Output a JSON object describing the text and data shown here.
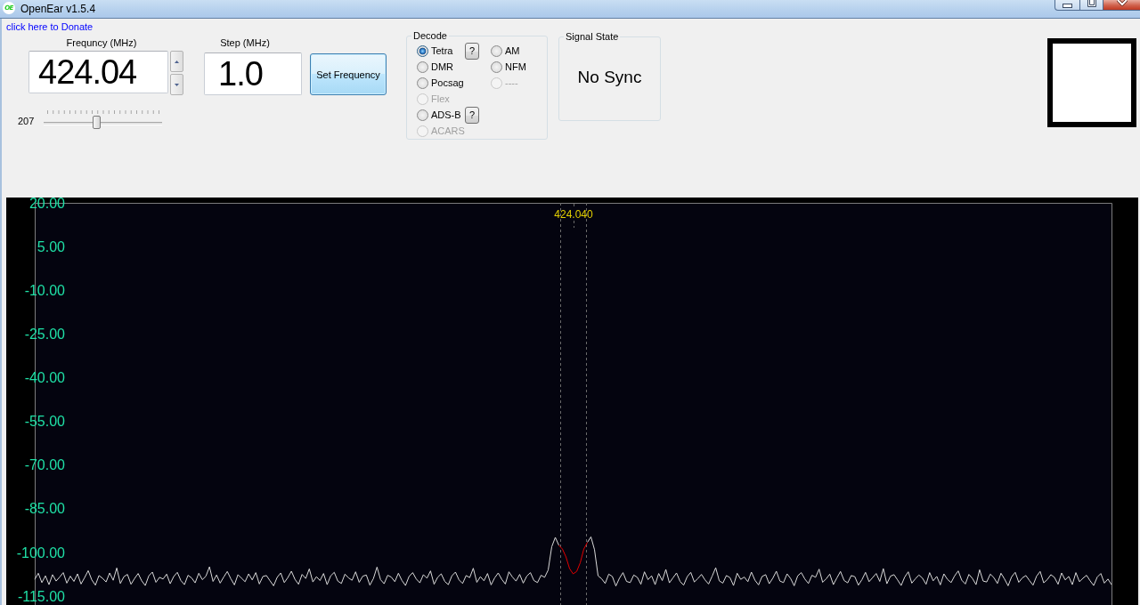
{
  "window": {
    "logo": "OE",
    "title": "OpenEar v1.5.4"
  },
  "donate_link": "click here to Donate",
  "frequency": {
    "label": "Frequncy (MHz)",
    "value": "424.04"
  },
  "step": {
    "label": "Step (MHz)",
    "value": "1.0"
  },
  "set_frequency_button": "Set Frequency",
  "slider": {
    "reading": "207",
    "level": 0.44
  },
  "decode": {
    "title": "Decode",
    "columns": [
      {
        "options": [
          {
            "label": "Tetra",
            "selected": true,
            "disabled": false,
            "help": "?"
          },
          {
            "label": "DMR",
            "selected": false,
            "disabled": false
          },
          {
            "label": "Pocsag",
            "selected": false,
            "disabled": false
          },
          {
            "label": "Flex",
            "selected": false,
            "disabled": true
          },
          {
            "label": "ADS-B",
            "selected": false,
            "disabled": false,
            "help": "?"
          },
          {
            "label": "ACARS",
            "selected": false,
            "disabled": true
          }
        ]
      },
      {
        "options": [
          {
            "label": "AM",
            "selected": false,
            "disabled": false
          },
          {
            "label": "NFM",
            "selected": false,
            "disabled": false
          },
          {
            "label": "----",
            "selected": false,
            "disabled": true
          }
        ]
      }
    ]
  },
  "signal_state": {
    "title": "Signal State",
    "value": "No Sync"
  },
  "spectrum": {
    "chart_data": {
      "type": "line",
      "ylim": [
        -118,
        20
      ],
      "yticks": [
        {
          "value": 20,
          "label": "20.00"
        },
        {
          "value": 5,
          "label": "5.00"
        },
        {
          "value": -10,
          "label": "-10.00"
        },
        {
          "value": -25,
          "label": "-25.00"
        },
        {
          "value": -40,
          "label": "-40.00"
        },
        {
          "value": -55,
          "label": "-55.00"
        },
        {
          "value": -70,
          "label": "-70.00"
        },
        {
          "value": -85,
          "label": "-85.00"
        },
        {
          "value": -100,
          "label": "-100.00"
        },
        {
          "value": -115,
          "label": "-115.00"
        }
      ],
      "tick_labels": "y",
      "annotations": [
        "424.040"
      ],
      "series": [
        {
          "color": "#d9d9d9",
          "values": [
            -109.2,
            -107.1,
            -110.3,
            -108.0,
            -111.0,
            -107.6,
            -109.8,
            -108.4,
            -106.9,
            -110.5,
            -108.1,
            -109.9,
            -107.3,
            -110.8,
            -108.6,
            -106.2,
            -109.4,
            -111.2,
            -107.9,
            -108.8,
            -110.1,
            -107.0,
            -109.5,
            -105.3,
            -110.6,
            -108.3,
            -107.5,
            -110.9,
            -108.9,
            -107.2,
            -109.7,
            -111.3,
            -108.0,
            -106.7,
            -110.2,
            -108.5,
            -109.1,
            -107.4,
            -110.7,
            -108.2,
            -106.8,
            -109.6,
            -111.0,
            -107.8,
            -108.7,
            -110.4,
            -107.1,
            -109.3,
            -108.1,
            -104.9,
            -109.9,
            -107.7,
            -110.5,
            -108.4,
            -106.5,
            -109.0,
            -111.1,
            -107.6,
            -108.8,
            -110.0,
            -107.3,
            -109.4,
            -106.9,
            -110.8,
            -108.2,
            -107.9,
            -109.7,
            -111.4,
            -108.5,
            -107.0,
            -110.3,
            -108.6,
            -106.4,
            -109.2,
            -110.9,
            -107.5,
            -108.9,
            -105.6,
            -110.1,
            -108.3,
            -109.6,
            -107.2,
            -111.0,
            -108.0,
            -106.8,
            -109.8,
            -110.6,
            -107.4,
            -108.7,
            -109.5,
            -106.6,
            -110.2,
            -108.1,
            -107.7,
            -111.2,
            -108.9,
            -105.0,
            -109.3,
            -110.7,
            -107.8,
            -108.4,
            -110.0,
            -107.1,
            -109.6,
            -111.3,
            -108.2,
            -106.9,
            -109.1,
            -110.4,
            -107.6,
            -108.8,
            -106.3,
            -110.9,
            -108.5,
            -107.3,
            -109.9,
            -111.0,
            -108.0,
            -106.7,
            -109.4,
            -110.6,
            -107.9,
            -108.6,
            -105.4,
            -110.2,
            -108.3,
            -109.7,
            -107.2,
            -111.1,
            -108.7,
            -107.0,
            -109.2,
            -110.8,
            -106.6,
            -108.4,
            -109.8,
            -107.5,
            -110.5,
            -108.1,
            -106.9,
            -109.6,
            -110.3,
            -107.8,
            -108.5,
            -106.0,
            -98.0,
            -94.8,
            -97.5,
            null,
            null,
            null,
            null,
            null,
            null,
            null,
            -96.5,
            -94.6,
            -99.0,
            -108.0,
            -109.0,
            -110.6,
            -107.4,
            -108.2,
            -111.5,
            -108.8,
            -106.9,
            -109.9,
            -110.3,
            -107.7,
            -108.5,
            -110.9,
            -106.6,
            -109.3,
            -108.0,
            -111.0,
            -107.2,
            -109.6,
            -105.8,
            -110.4,
            -108.7,
            -107.0,
            -109.9,
            -111.2,
            -108.3,
            -106.8,
            -110.1,
            -108.9,
            -107.5,
            -109.4,
            -110.8,
            -108.1,
            -105.2,
            -109.7,
            -110.5,
            -107.9,
            -108.6,
            -111.3,
            -107.1,
            -109.2,
            -108.4,
            -110.0,
            -106.7,
            -109.5,
            -111.1,
            -108.2,
            -107.6,
            -110.7,
            -108.8,
            -106.4,
            -109.8,
            -110.3,
            -107.3,
            -108.9,
            -111.4,
            -108.0,
            -106.9,
            -109.1,
            -110.6,
            -107.8,
            -108.5,
            -105.7,
            -110.2,
            -109.0,
            -107.4,
            -111.0,
            -108.7,
            -106.5,
            -109.6,
            -110.4,
            -107.9,
            -108.3,
            -111.2,
            -109.3,
            -106.8,
            -110.0,
            -108.6,
            -107.2,
            -109.9,
            -105.5,
            -110.7,
            -108.1,
            -107.6,
            -109.4,
            -111.3,
            -108.4,
            -106.6,
            -110.5,
            -109.0,
            -107.7,
            -108.8,
            -110.9,
            -106.9,
            -109.7,
            -108.2,
            -111.1,
            -107.3,
            -109.2,
            -110.3,
            -108.0,
            -106.3,
            -109.5,
            -110.8,
            -107.5,
            -108.9,
            -111.0,
            -105.9,
            -109.8,
            -110.1,
            -107.4,
            -108.6,
            -110.6,
            -107.1,
            -109.1,
            -111.4,
            -108.3,
            -106.8,
            -110.2,
            -108.7,
            -107.9,
            -109.6,
            -111.2,
            -108.1,
            -106.5,
            -110.4,
            -109.3,
            -107.6,
            -108.5,
            -110.9,
            -107.0,
            -109.4,
            -108.2,
            -111.0,
            -106.9,
            -110.0,
            -108.8,
            -107.8,
            -109.7,
            -111.3,
            -108.4,
            -107.2,
            -110.5,
            -109.1,
            -111.0
          ]
        },
        {
          "color": "#e00000",
          "values": [
            null,
            null,
            null,
            null,
            null,
            null,
            null,
            null,
            null,
            null,
            null,
            null,
            null,
            null,
            null,
            null,
            null,
            null,
            null,
            null,
            null,
            null,
            null,
            null,
            null,
            null,
            null,
            null,
            null,
            null,
            null,
            null,
            null,
            null,
            null,
            null,
            null,
            null,
            null,
            null,
            null,
            null,
            null,
            null,
            null,
            null,
            null,
            null,
            null,
            null,
            null,
            null,
            null,
            null,
            null,
            null,
            null,
            null,
            null,
            null,
            null,
            null,
            null,
            null,
            null,
            null,
            null,
            null,
            null,
            null,
            null,
            null,
            null,
            null,
            null,
            null,
            null,
            null,
            null,
            null,
            null,
            null,
            null,
            null,
            null,
            null,
            null,
            null,
            null,
            null,
            null,
            null,
            null,
            null,
            null,
            null,
            null,
            null,
            null,
            null,
            null,
            null,
            null,
            null,
            null,
            null,
            null,
            null,
            null,
            null,
            null,
            null,
            null,
            null,
            null,
            null,
            null,
            null,
            null,
            null,
            null,
            null,
            null,
            null,
            null,
            null,
            null,
            null,
            null,
            null,
            null,
            null,
            null,
            null,
            null,
            null,
            null,
            null,
            null,
            null,
            null,
            null,
            null,
            null,
            null,
            null,
            null,
            -97.5,
            -98.8,
            -101.5,
            -105.5,
            -107.3,
            -106.5,
            -103.5,
            -98.8,
            -96.5,
            null,
            null,
            null,
            null,
            null,
            null,
            null,
            null,
            null,
            null,
            null,
            null,
            null,
            null,
            null,
            null,
            null,
            null,
            null,
            null,
            null,
            null,
            null,
            null,
            null,
            null,
            null,
            null,
            null,
            null,
            null,
            null,
            null,
            null,
            null,
            null,
            null,
            null,
            null,
            null,
            null,
            null,
            null,
            null,
            null,
            null,
            null,
            null,
            null,
            null,
            null,
            null,
            null,
            null,
            null,
            null,
            null,
            null,
            null,
            null,
            null,
            null,
            null,
            null,
            null,
            null,
            null,
            null,
            null,
            null,
            null,
            null,
            null,
            null,
            null,
            null,
            null,
            null,
            null,
            null,
            null,
            null,
            null,
            null,
            null,
            null,
            null,
            null,
            null,
            null,
            null,
            null,
            null,
            null,
            null,
            null,
            null,
            null,
            null,
            null,
            null,
            null,
            null,
            null,
            null,
            null,
            null,
            null,
            null,
            null,
            null,
            null,
            null,
            null,
            null,
            null,
            null,
            null,
            null,
            null,
            null,
            null,
            null,
            null,
            null,
            null,
            null,
            null,
            null,
            null,
            null,
            null,
            null,
            null,
            null,
            null,
            null,
            null,
            null,
            null,
            null,
            null,
            null,
            null,
            null,
            null,
            null
          ]
        }
      ]
    }
  }
}
